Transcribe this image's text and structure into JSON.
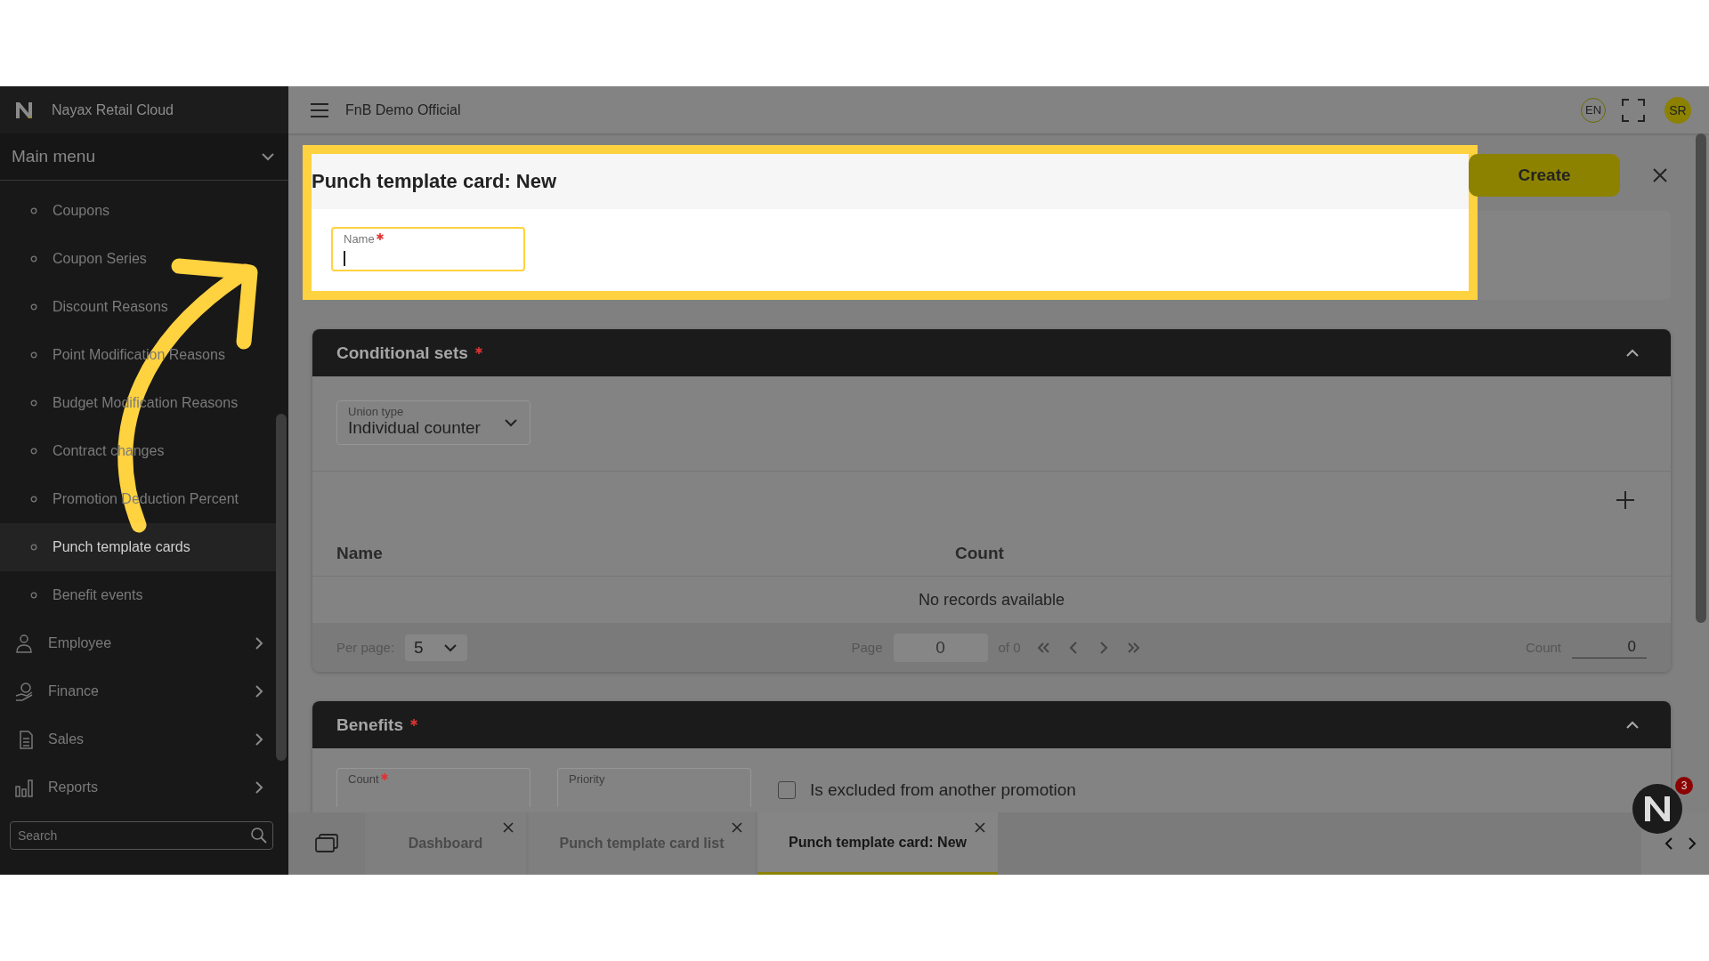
{
  "app": {
    "title": "Nayax Retail Cloud"
  },
  "sidebar": {
    "menu_title": "Main menu",
    "expanded": true,
    "subitems": [
      {
        "label": "Coupons",
        "selected": false
      },
      {
        "label": "Coupon Series",
        "selected": false
      },
      {
        "label": "Discount Reasons",
        "selected": false
      },
      {
        "label": "Point Modification Reasons",
        "selected": false
      },
      {
        "label": "Budget Modification Reasons",
        "selected": false
      },
      {
        "label": "Contract changes",
        "selected": false
      },
      {
        "label": "Promotion Deduction Percent",
        "selected": false
      },
      {
        "label": "Punch template cards",
        "selected": true
      },
      {
        "label": "Benefit events",
        "selected": false
      }
    ],
    "groups": [
      {
        "label": "Employee"
      },
      {
        "label": "Finance"
      },
      {
        "label": "Sales"
      },
      {
        "label": "Reports"
      }
    ],
    "search": {
      "placeholder": "Search"
    }
  },
  "topbar": {
    "company": "FnB Demo Official",
    "language": "EN",
    "avatar": "SR"
  },
  "form": {
    "title": "Punch template card: New",
    "create": "Create",
    "name_field": {
      "label": "Name",
      "required": true,
      "focused": true
    }
  },
  "conditional_sets": {
    "title": "Conditional sets",
    "required": true,
    "expanded": true,
    "union_type": {
      "label": "Union type",
      "value": "Individual counter"
    },
    "columns": [
      "Name",
      "Count"
    ],
    "empty": "No records available",
    "pager": {
      "per_page_label": "Per page:",
      "per_page": "5",
      "page_label": "Page",
      "page": "0",
      "of": "of 0",
      "count_label": "Count",
      "count": "0"
    }
  },
  "benefits": {
    "title": "Benefits",
    "required": true,
    "expanded": true,
    "fields": [
      {
        "label": "Count",
        "required": true
      },
      {
        "label": "Priority",
        "required": false
      }
    ],
    "checkbox": {
      "label": "Is excluded from another promotion",
      "checked": false
    }
  },
  "tabs": [
    {
      "label": "Dashboard",
      "selected": false
    },
    {
      "label": "Punch template card list",
      "selected": false
    },
    {
      "label": "Punch template card: New",
      "selected": true
    }
  ],
  "chat": {
    "badge": "3"
  }
}
